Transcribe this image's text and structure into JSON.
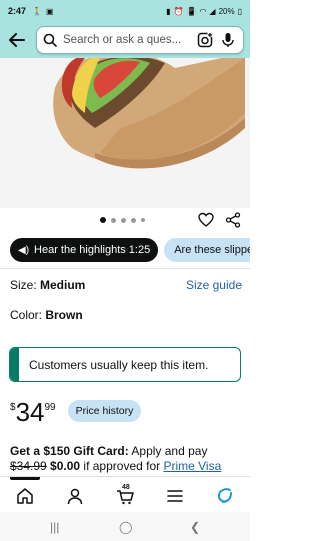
{
  "status": {
    "time": "2:47",
    "battery": "20%",
    "left_icons": [
      "walk-icon",
      "image-icon"
    ],
    "right_icons": [
      "battery-saver-icon",
      "alarm-icon",
      "vibrate-icon",
      "wifi-icon",
      "signal-icon",
      "battery-icon"
    ]
  },
  "search": {
    "placeholder": "Search or ask a ques..."
  },
  "image": {
    "dots_count": 5,
    "active_dot": 1
  },
  "highlights": {
    "audio_label": "Hear the highlights 1:25",
    "question_chip": "Are these slippers"
  },
  "options": {
    "size_label": "Size: ",
    "size_value": "Medium",
    "size_guide": "Size guide",
    "color_label": "Color: ",
    "color_value": "Brown"
  },
  "keep": {
    "text": "Customers usually keep this item."
  },
  "price": {
    "currency": "$",
    "dollars": "34",
    "cents": "99",
    "history_label": "Price history"
  },
  "gift": {
    "line1_bold": "Get a $150 Gift Card:",
    "line1_rest": " Apply and pay",
    "old_price": "$34.99",
    "new_price": " $0.00",
    "line2_rest": " if approved for ",
    "visa_link": "Prime Visa"
  },
  "nav": {
    "cart_count": "48",
    "items": [
      "home-icon",
      "account-icon",
      "cart-icon",
      "menu-icon",
      "assistant-icon"
    ]
  },
  "colors": {
    "header_bg": "#a9e3df",
    "link": "#2162a1",
    "keep_green": "#067d62",
    "chip_light": "#c7e2f5"
  }
}
